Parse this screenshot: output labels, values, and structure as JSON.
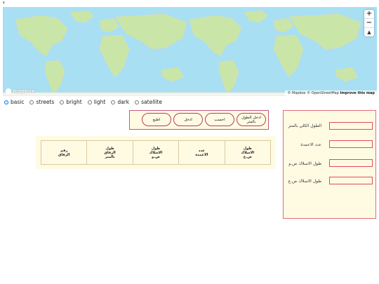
{
  "page": {
    "corner_mark": "s"
  },
  "map": {
    "zoom_in": "+",
    "zoom_out": "−",
    "compass": "▲",
    "logo_text": "mapbox",
    "attribution": "© Mapbox © OpenStreetMap",
    "improve": "Improve this map"
  },
  "styles": {
    "options": [
      "basic",
      "streets",
      "bright",
      "light",
      "dark",
      "satellite"
    ],
    "selected": "basic"
  },
  "actions": {
    "enter_length": "ادخل الطول\nبالمتر",
    "calculate": "احسب",
    "enter": "ادخل",
    "print": "اطبع"
  },
  "table": {
    "headers": [
      "طول\nالاسلاك\nض.ع",
      "عدد\nالاعمدة",
      "طول\nالاسلاك\nض.و",
      "طول\nالزقاق\nبالمتر",
      "رقم\nالزقاق"
    ]
  },
  "form": {
    "total_length": "الطول الكلي بالمتر",
    "poles_count": "عدد الاعمدة",
    "mv_wires": "طول الاسلاك ض.و",
    "hv_wires": "طول الاسلاك ض.ع"
  }
}
